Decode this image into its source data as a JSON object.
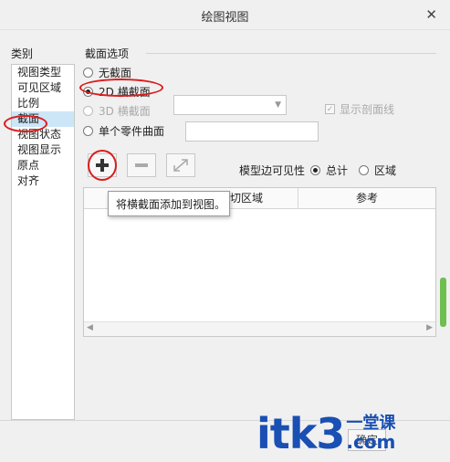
{
  "window": {
    "title": "绘图视图",
    "close_glyph": "✕"
  },
  "categories": {
    "label": "类别",
    "items": [
      "视图类型",
      "可见区域",
      "比例",
      "截面",
      "视图状态",
      "视图显示",
      "原点",
      "对齐"
    ],
    "selected": "截面"
  },
  "section_options": {
    "label": "截面选项",
    "options": [
      {
        "label": "无截面",
        "checked": false,
        "disabled": false
      },
      {
        "label": "2D 横截面",
        "checked": true,
        "disabled": false
      },
      {
        "label": "3D 横截面",
        "checked": false,
        "disabled": true
      },
      {
        "label": "单个零件曲面",
        "checked": false,
        "disabled": false
      }
    ],
    "show_section_line": {
      "label": "显示剖面线",
      "checked": true,
      "disabled": true
    }
  },
  "toolbar": {
    "add_icon": "plus-icon",
    "remove_icon": "minus-icon",
    "flip_icon": "flip-arrows-icon",
    "add_tooltip": "将横截面添加到视图。"
  },
  "model_edge_visibility": {
    "label": "模型边可见性",
    "options": [
      {
        "label": "总计",
        "checked": true
      },
      {
        "label": "区域",
        "checked": false
      }
    ]
  },
  "table": {
    "columns": [
      "切区域",
      "参考"
    ]
  },
  "footer": {
    "button_label": "确定"
  },
  "watermark": {
    "main": "itk3",
    "cn": "一堂课",
    "com": ".com"
  },
  "colors": {
    "annotation_red": "#d91e1e",
    "selection_blue": "#cde6f7",
    "watermark_blue": "#1a4fb3",
    "scroll_green": "#6fbf50"
  }
}
